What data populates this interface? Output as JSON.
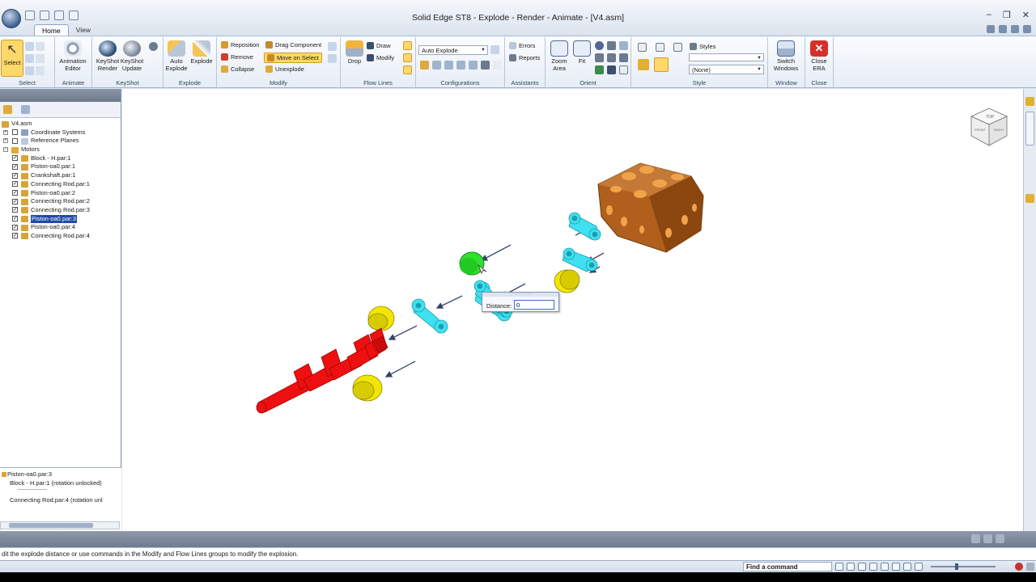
{
  "window": {
    "title": "Solid Edge ST8 - Explode - Render - Animate - [V4.asm]"
  },
  "tabs": [
    "Home",
    "View"
  ],
  "ribbon": {
    "select": {
      "label": "Select",
      "group": "Select"
    },
    "animate": {
      "animation_editor": "Animation Editor",
      "group": "Animate"
    },
    "keyshot": {
      "render": "KeyShot Render",
      "update": "KeyShot Update",
      "group": "KeyShot"
    },
    "explode": {
      "auto_explode": "Auto Explode",
      "explode": "Explode",
      "group": "Explode"
    },
    "modify": {
      "reposition": "Reposition",
      "remove": "Remove",
      "collapse": "Collapse",
      "drag_component": "Drag Component",
      "move_on_select": "Move on Select",
      "unexplode": "Unexplode",
      "group": "Modify"
    },
    "flow_lines": {
      "drop": "Drop",
      "draw": "Draw",
      "modify": "Modify",
      "group": "Flow Lines"
    },
    "configurations": {
      "combo_value": "Auto Explode",
      "group": "Configurations"
    },
    "assistants": {
      "errors": "Errors",
      "reports": "Reports",
      "group": "Assistants"
    },
    "orient": {
      "zoom_area": "Zoom Area",
      "fit": "Fit",
      "group": "Orient"
    },
    "style": {
      "styles": "Styles",
      "combo_value": "(None)",
      "group": "Style"
    },
    "window_grp": {
      "switch_windows": "Switch Windows",
      "group": "Window"
    },
    "close": {
      "close_era": "Close ERA",
      "group": "Close"
    }
  },
  "pathfinder": {
    "root": "V4.asm",
    "items": [
      {
        "label": "Coordinate Systems",
        "level": 0
      },
      {
        "label": "Reference Planes",
        "level": 0
      },
      {
        "label": "Motors",
        "level": 0
      },
      {
        "label": "Block - H.par:1",
        "level": 1
      },
      {
        "label": "Piston-oa0.par:1",
        "level": 1
      },
      {
        "label": "Crankshaft.par:1",
        "level": 1
      },
      {
        "label": "Connecting Rod.par:1",
        "level": 1
      },
      {
        "label": "Piston-oa0.par:2",
        "level": 1
      },
      {
        "label": "Connecting Rod.par:2",
        "level": 1
      },
      {
        "label": "Connecting Rod.par:3",
        "level": 1
      },
      {
        "label": "Piston-oa0.par:3",
        "level": 1,
        "selected": true
      },
      {
        "label": "Piston-oa0.par:4",
        "level": 1
      },
      {
        "label": "Connecting Rod.par:4",
        "level": 1
      }
    ],
    "relations": {
      "title": "Piston-oa0.par:3",
      "r1": "Block - H.par:1  (rotation unlocked)",
      "sep": "------------------",
      "r2": "Connecting Rod.par:4  (rotation unl"
    }
  },
  "distance_dialog": {
    "label": "Distance:",
    "value": "0"
  },
  "prompt": "dit the explode distance or use commands in the Modify and Flow Lines groups to modify the explosion.",
  "statusbar": {
    "find_command": "Find a command"
  },
  "colors": {
    "piston": "#f2e600",
    "rod": "#3fe0ef",
    "crank": "#ee1010",
    "block": "#b0601c",
    "selected": "#2fe02f",
    "accent": "#1f4aa6"
  },
  "navcube": {
    "top": "TOP",
    "front": "FRONT",
    "right": "RIGHT"
  }
}
